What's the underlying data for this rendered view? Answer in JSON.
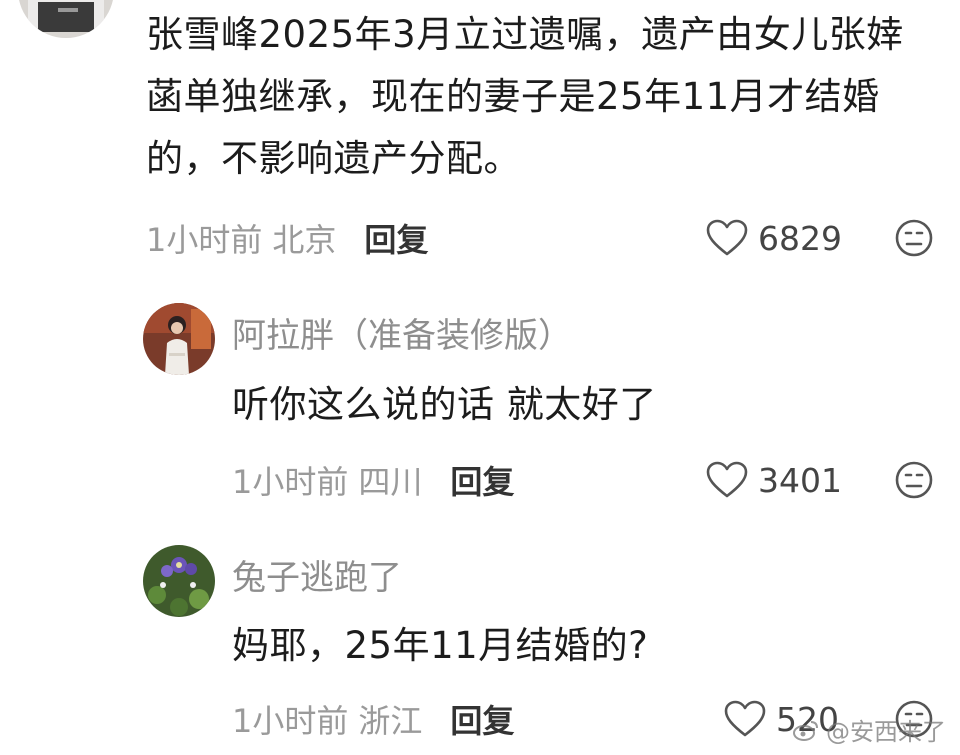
{
  "comments": [
    {
      "text": "张雪峰2025年3月立过遗嘱，遗产由女儿张婞菡单独继承，现在的妻子是25年11月才结婚的，不影响遗产分配。",
      "time": "1小时前",
      "location": "北京",
      "reply_label": "回复",
      "likes": "6829"
    },
    {
      "username": "阿拉胖（准备装修版）",
      "text": "听你这么说的话 就太好了",
      "time": "1小时前",
      "location": "四川",
      "reply_label": "回复",
      "likes": "3401"
    },
    {
      "username": "兔子逃跑了",
      "text": "妈耶，25年11月结婚的?",
      "time": "1小时前",
      "location": "浙江",
      "reply_label": "回复",
      "likes": "520"
    }
  ],
  "watermark": "@安西来了",
  "icons": {
    "like": "heart-outline-icon",
    "dislike": "neutral-face-icon",
    "watermark_logo": "weibo-logo-icon"
  },
  "colors": {
    "text": "#1c1c1c",
    "meta": "#9a9a9a",
    "username": "#8e8e8e",
    "reply": "#333333"
  }
}
